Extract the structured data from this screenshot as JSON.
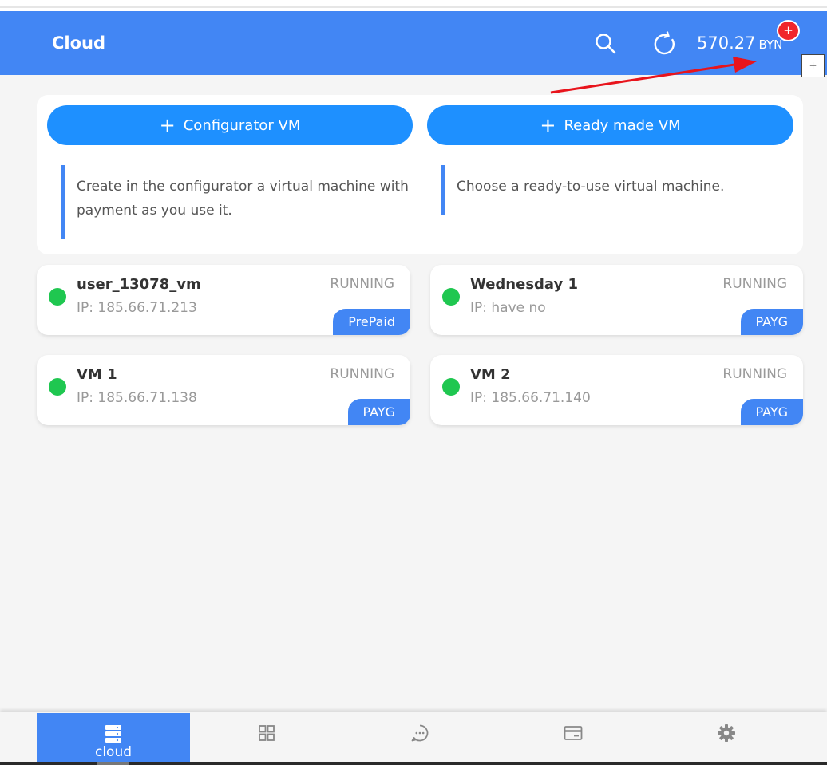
{
  "header": {
    "title": "Cloud",
    "balance_amount": "570.27",
    "balance_currency": "BYN",
    "badge_label": "+",
    "add_label": "+",
    "icons": [
      "search-icon",
      "refresh-icon"
    ]
  },
  "create": {
    "configurator_button": "Configurator VM",
    "ready_button": "Ready made VM",
    "plus_glyph": "+",
    "configurator_desc": "Create in the configurator a virtual machine with payment as you use it.",
    "ready_desc": "Choose a ready-to-use virtual machine."
  },
  "vms": [
    {
      "name": "user_13078_vm",
      "ip": "IP: 185.66.71.213",
      "status": "RUNNING",
      "plan": "PrePaid"
    },
    {
      "name": "Wednesday 1",
      "ip": "IP: have no",
      "status": "RUNNING",
      "plan": "PAYG"
    },
    {
      "name": "VM 1",
      "ip": "IP: 185.66.71.138",
      "status": "RUNNING",
      "plan": "PAYG"
    },
    {
      "name": "VM 2",
      "ip": "IP: 185.66.71.140",
      "status": "RUNNING",
      "plan": "PAYG"
    }
  ],
  "nav": {
    "active_label": "cloud",
    "items": [
      "server-icon",
      "grid-icon",
      "chat-icon",
      "card-icon",
      "gear-icon"
    ]
  },
  "colors": {
    "header": "#4286f4",
    "button": "#1e90ff",
    "running_dot": "#1fc750",
    "badge": "#f0262c",
    "annotation_arrow": "#e8141c"
  }
}
